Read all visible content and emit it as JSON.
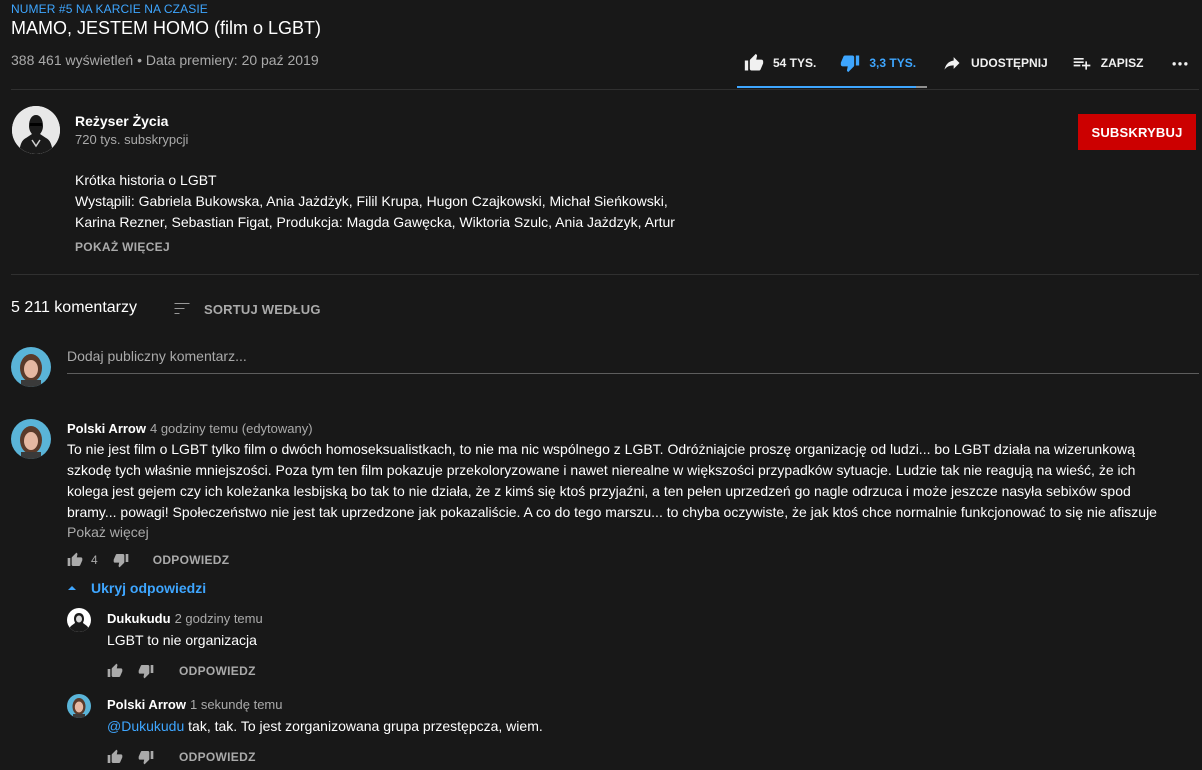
{
  "video": {
    "trending": "NUMER #5 NA KARCIE NA CZASIE",
    "title": "MAMO, JESTEM HOMO (film o LGBT)",
    "meta": "388 461 wyświetleń • Data premiery: 20 paź 2019",
    "likes": "54 TYS.",
    "dislikes": "3,3 TYS.",
    "share_label": "UDOSTĘPNIJ",
    "save_label": "ZAPISZ",
    "like_ratio": 0.94
  },
  "channel": {
    "name": "Reżyser Życia",
    "subscribers": "720 tys. subskrypcji",
    "subscribe_label": "SUBSKRYBUJ"
  },
  "description": {
    "line1": "Krótka historia o LGBT",
    "line2": "Wystąpili: Gabriela Bukowska,  Ania Jażdżyk, Filil Krupa, Hugon Czajkowski, Michał Sieńkowski,",
    "line3": "Karina Rezner, Sebastian Figat,  Produkcja:  Magda Gawęcka, Wiktoria Szulc, Ania Jażdzyk, Artur",
    "show_more": "POKAŻ WIĘCEJ"
  },
  "comments_header": {
    "count": "5 211 komentarzy",
    "sort_label": "SORTUJ WEDŁUG",
    "placeholder": "Dodaj publiczny komentarz..."
  },
  "comments": [
    {
      "author": "Polski Arrow",
      "time": "4 godziny temu (edytowany)",
      "lines": [
        "To nie jest film o LGBT tylko film o dwóch homoseksualistkach, to nie ma nic wspólnego z LGBT. Odróżniajcie proszę organizację od ludzi... bo LGBT działa na wizerunkową",
        "szkodę tych właśnie mniejszości. Poza tym ten film pokazuje przekoloryzowane i nawet nierealne w większości przypadków sytuacje. Ludzie tak nie reagują na wieść, że ich",
        "kolega jest gejem czy ich koleżanka lesbijską bo tak to nie działa, że z kimś się ktoś przyjaźni, a ten pełen uprzedzeń go nagle odrzuca i może jeszcze nasyła sebixów spod",
        "bramy... powagi! Społeczeństwo nie jest tak uprzedzone jak pokazaliście. A co do tego marszu... to chyba oczywiste, że jak ktoś chce normalnie funkcjonować to się nie afiszuje"
      ],
      "show_more": "Pokaż więcej",
      "likes": "4",
      "reply_label": "ODPOWIEDZ",
      "hide_replies": "Ukryj odpowiedzi"
    }
  ],
  "replies": [
    {
      "author": "Dukukudu",
      "time": "2 godziny temu",
      "text": "LGBT to nie organizacja",
      "reply_label": "ODPOWIEDZ"
    },
    {
      "author": "Polski Arrow",
      "time": "1 sekundę temu",
      "mention": "@Dukukudu",
      "text": " tak, tak. To jest zorganizowana grupa przestępcza, wiem.",
      "reply_label": "ODPOWIEDZ"
    }
  ],
  "icons": {
    "like": "thumbs-up-icon",
    "dislike": "thumbs-down-icon",
    "share": "share-icon",
    "save": "playlist-add-icon",
    "more": "more-horizontal-icon",
    "sort": "sort-icon",
    "collapse": "caret-up-icon"
  },
  "colors": {
    "background": "#181818",
    "accent": "#3ea6ff",
    "subscribe": "#cc0000",
    "muted_text": "#aaaaaa"
  }
}
